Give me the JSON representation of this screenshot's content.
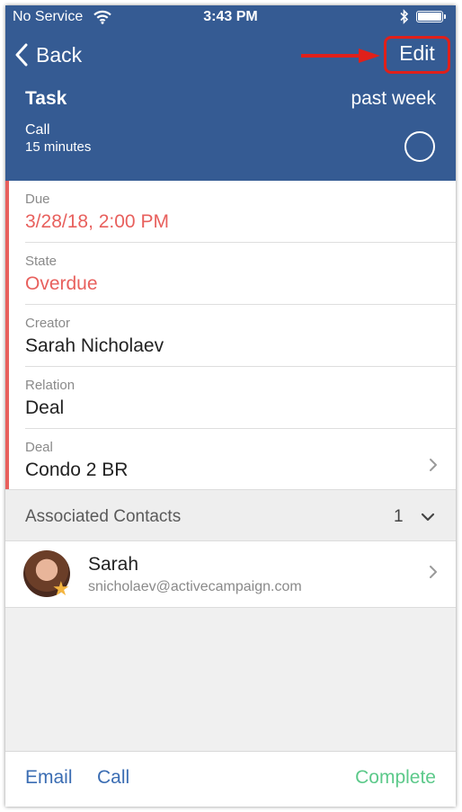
{
  "status_bar": {
    "carrier": "No Service",
    "time": "3:43 PM",
    "wifi_icon": "wifi-icon",
    "bluetooth_icon": "bluetooth-icon",
    "battery_icon": "battery-icon"
  },
  "nav": {
    "back_label": "Back",
    "edit_label": "Edit"
  },
  "task": {
    "title": "Task",
    "timeframe": "past week",
    "type": "Call",
    "duration": "15 minutes"
  },
  "fields": [
    {
      "label": "Due",
      "value": "3/28/18, 2:00 PM"
    },
    {
      "label": "State",
      "value": "Overdue"
    },
    {
      "label": "Creator",
      "value": "Sarah Nicholaev"
    },
    {
      "label": "Relation",
      "value": "Deal"
    },
    {
      "label": "Deal",
      "value": "Condo 2 BR"
    }
  ],
  "associated_contacts": {
    "title": "Associated Contacts",
    "count": "1",
    "contacts": [
      {
        "name": "Sarah",
        "email": "snicholaev@activecampaign.com"
      }
    ]
  },
  "toolbar": {
    "email_label": "Email",
    "call_label": "Call",
    "complete_label": "Complete"
  },
  "colors": {
    "header_bg": "#355b93",
    "overdue_red": "#e8605d",
    "link_blue": "#3b6db3",
    "complete_green": "#5cc98a",
    "annotation_red": "#e0201a"
  }
}
